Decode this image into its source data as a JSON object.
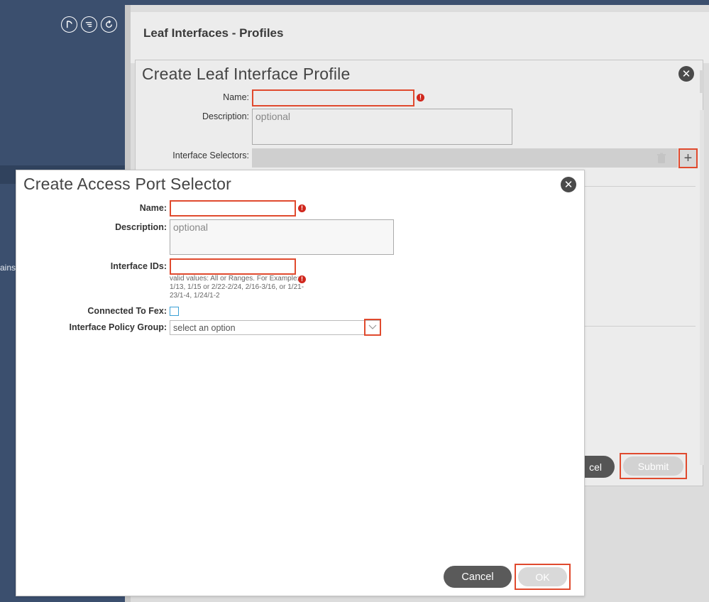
{
  "sidebar": {
    "icons": [
      "info-icon",
      "list-icon",
      "refresh-icon"
    ],
    "partial_text": "ains"
  },
  "page": {
    "title": "Leaf Interfaces - Profiles"
  },
  "profile_dialog": {
    "title": "Create Leaf Interface Profile",
    "name_label": "Name:",
    "name_value": "",
    "description_label": "Description:",
    "description_placeholder": "optional",
    "selectors_label": "Interface Selectors:",
    "cancel_partial": "cel",
    "submit_label": "Submit"
  },
  "selector_dialog": {
    "title": "Create Access Port Selector",
    "name_label": "Name:",
    "name_value": "",
    "description_label": "Description:",
    "description_placeholder": "optional",
    "interface_ids_label": "Interface IDs:",
    "interface_ids_value": "",
    "interface_ids_hint": "valid values: All or Ranges. For Example: 1/13, 1/15 or 2/22-2/24, 2/16-3/16, or 1/21-23/1-4, 1/24/1-2",
    "fex_label": "Connected To Fex:",
    "policy_group_label": "Interface Policy Group:",
    "policy_group_placeholder": "select an option",
    "cancel_label": "Cancel",
    "ok_label": "OK"
  },
  "colors": {
    "sidebar": "#3b4f6e",
    "highlight": "#e04a2e",
    "error": "#d0271d",
    "checkbox": "#3aa0d5"
  }
}
